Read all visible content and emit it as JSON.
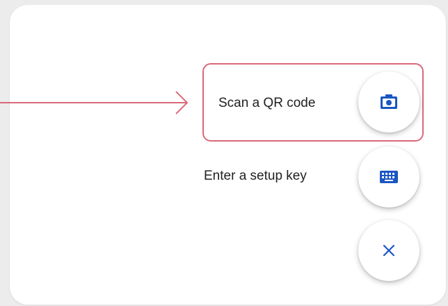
{
  "menu": {
    "items": [
      {
        "label": "Scan a QR code",
        "icon": "camera-icon"
      },
      {
        "label": "Enter a setup key",
        "icon": "keyboard-icon"
      }
    ],
    "close_icon": "close-icon"
  },
  "annotation": {
    "highlight_color": "#d9687a"
  },
  "colors": {
    "accent": "#1a56c4",
    "text": "#202124",
    "card": "#ffffff"
  }
}
